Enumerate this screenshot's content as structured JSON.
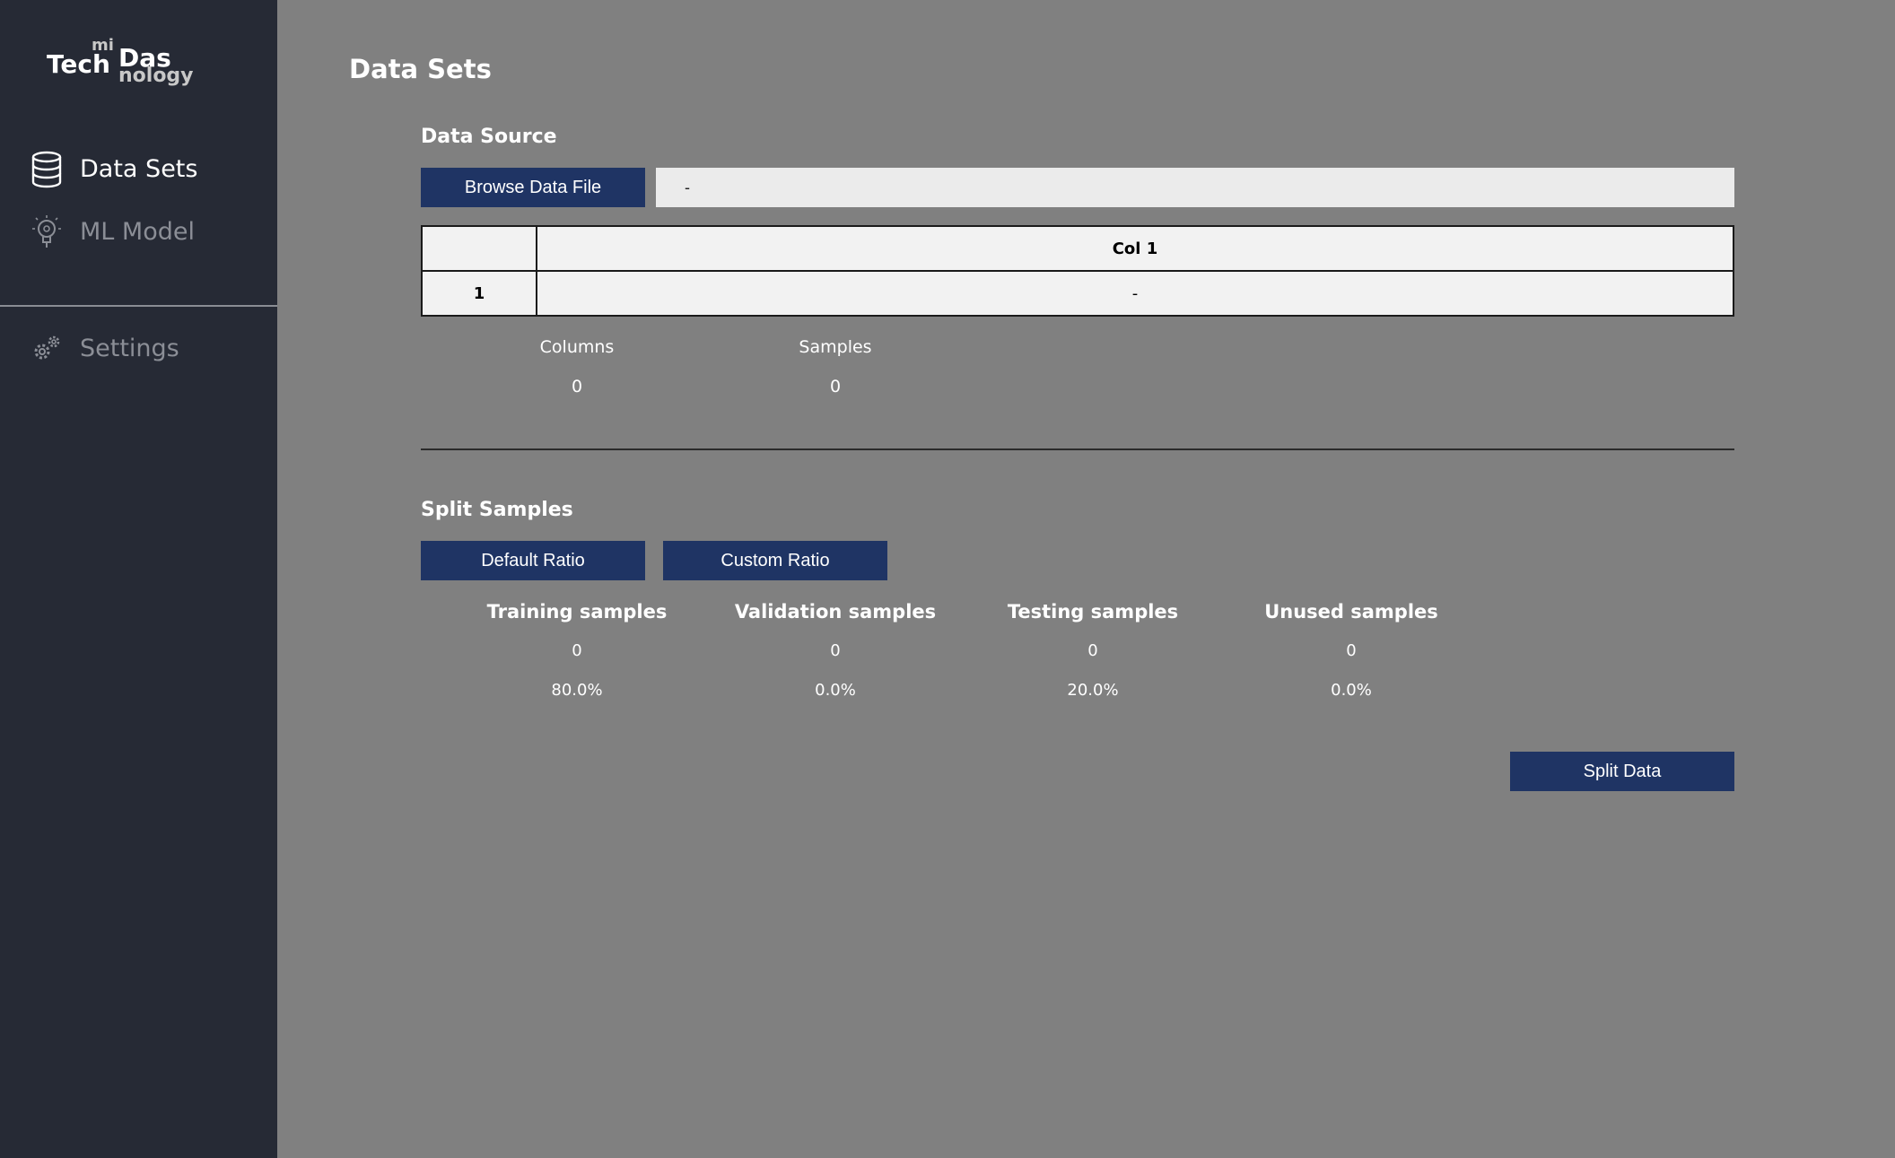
{
  "logo": {
    "part_mi": "mi",
    "part_tech": "Tech",
    "part_das": "Das",
    "part_nology": "nology"
  },
  "sidebar": {
    "items": [
      {
        "label": "Data Sets",
        "icon": "database-icon",
        "active": true
      },
      {
        "label": "ML Model",
        "icon": "lightbulb-icon",
        "active": false
      },
      {
        "label": "Settings",
        "icon": "gears-icon",
        "active": false
      }
    ]
  },
  "main": {
    "title": "Data Sets",
    "data_source": {
      "title": "Data Source",
      "browse_label": "Browse Data File",
      "file_path": "-",
      "table": {
        "columns": [
          "",
          "Col 1"
        ],
        "rows": [
          [
            "1",
            "-"
          ]
        ]
      },
      "stats": {
        "columns_label": "Columns",
        "columns_value": "0",
        "samples_label": "Samples",
        "samples_value": "0"
      }
    },
    "split": {
      "title": "Split Samples",
      "default_ratio_label": "Default Ratio",
      "custom_ratio_label": "Custom Ratio",
      "groups": [
        {
          "label": "Training samples",
          "count": "0",
          "percent": "80.0%"
        },
        {
          "label": "Validation samples",
          "count": "0",
          "percent": "0.0%"
        },
        {
          "label": "Testing samples",
          "count": "0",
          "percent": "20.0%"
        },
        {
          "label": "Unused samples",
          "count": "0",
          "percent": "0.0%"
        }
      ],
      "split_button_label": "Split Data"
    }
  },
  "colors": {
    "sidebar_bg": "#262a35",
    "main_bg": "#808080",
    "button_bg": "#1f3464",
    "active_text": "#ffffff",
    "inactive_text": "#8b8e96"
  }
}
